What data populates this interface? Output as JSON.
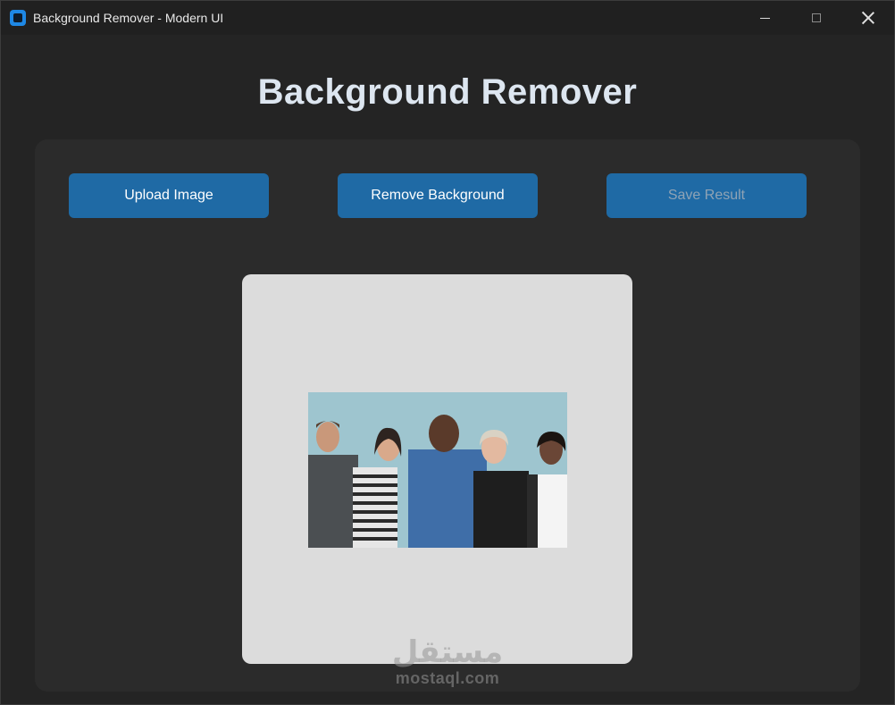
{
  "window": {
    "title": "Background Remover - Modern UI",
    "controls": {
      "minimize_icon": "minimize-icon",
      "maximize_icon": "maximize-icon",
      "close_icon": "close-icon"
    }
  },
  "header": {
    "title": "Background Remover"
  },
  "toolbar": {
    "upload_label": "Upload Image",
    "remove_label": "Remove Background",
    "save_label": "Save Result",
    "save_enabled": false
  },
  "preview": {
    "image_description_icon": "group-photo"
  },
  "watermark": {
    "logo_text": "مستقل",
    "site": "mostaql.com"
  },
  "colors": {
    "accent": "#1f6aa5",
    "background": "#242424",
    "panel": "#2b2b2b",
    "canvas": "#dcdcdc",
    "title_text": "#dde6f0"
  }
}
